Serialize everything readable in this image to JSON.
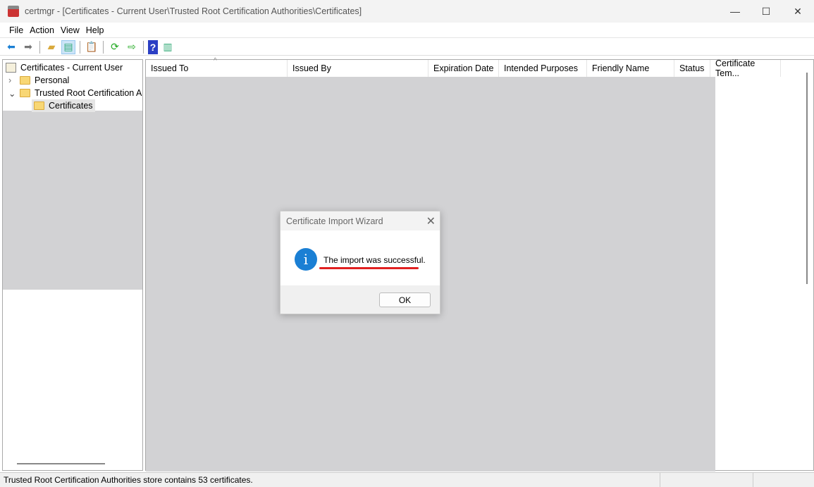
{
  "window": {
    "title": "certmgr - [Certificates - Current User\\Trusted Root Certification Authorities\\Certificates]",
    "minimize": "—",
    "maximize": "☐",
    "close": "✕"
  },
  "menu": [
    "File",
    "Action",
    "View",
    "Help"
  ],
  "toolbar": {
    "icons": [
      "back-icon",
      "forward-icon",
      "up-folder-icon",
      "show-hide-tree-icon",
      "properties-icon",
      "refresh-icon",
      "export-list-icon",
      "help-icon",
      "action-pane-icon"
    ]
  },
  "tree": {
    "root": "Certificates - Current User",
    "items": [
      {
        "label": "Personal",
        "expanded": false
      },
      {
        "label": "Trusted Root Certification Authorities",
        "expanded": true
      }
    ],
    "selected": "Certificates"
  },
  "columns": [
    "Issued To",
    "Issued By",
    "Expiration Date",
    "Intended Purposes",
    "Friendly Name",
    "Status",
    "Certificate Tem..."
  ],
  "dialog": {
    "title": "Certificate Import Wizard",
    "message": "The import was successful.",
    "ok": "OK",
    "annotation_color": "#e02020"
  },
  "status": "Trusted Root Certification Authorities store contains 53 certificates."
}
